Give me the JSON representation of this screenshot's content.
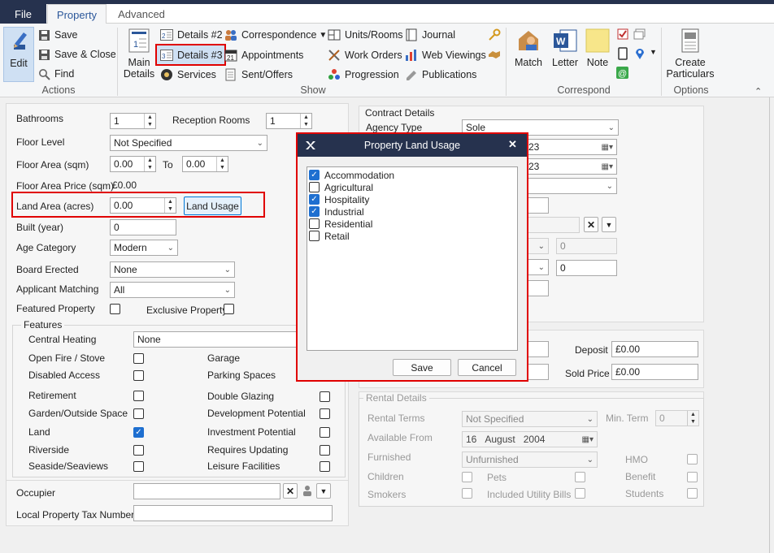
{
  "tabs": {
    "file": "File",
    "property": "Property",
    "advanced": "Advanced"
  },
  "ribbon": {
    "actions": {
      "edit": "Edit",
      "save": "Save",
      "save_close": "Save & Close",
      "find": "Find",
      "label": "Actions"
    },
    "show": {
      "main_details": [
        "Main",
        "Details"
      ],
      "details2": "Details #2",
      "details3": "Details #3",
      "services": "Services",
      "correspondence": "Correspondence",
      "appointments": "Appointments",
      "sent_offers": "Sent/Offers",
      "units_rooms": "Units/Rooms",
      "work_orders": "Work Orders",
      "progression": "Progression",
      "journal": "Journal",
      "web_viewings": "Web Viewings",
      "publications": "Publications",
      "label": "Show"
    },
    "correspond": {
      "match": "Match",
      "letter": "Letter",
      "note": "Note",
      "label": "Correspond"
    },
    "options": {
      "create": [
        "Create",
        "Particulars"
      ],
      "label": "Options"
    }
  },
  "form": {
    "bathrooms": {
      "label": "Bathrooms",
      "value": "1"
    },
    "reception": {
      "label": "Reception Rooms",
      "value": "1"
    },
    "floor_level": {
      "label": "Floor Level",
      "value": "Not Specified"
    },
    "floor_area": {
      "label": "Floor Area (sqm)",
      "from": "0.00",
      "to_label": "To",
      "to": "0.00"
    },
    "floor_price": {
      "label": "Floor Area Price (sqm)",
      "value": "£0.00"
    },
    "land_area": {
      "label": "Land Area (acres)",
      "value": "0.00",
      "button": "Land Usage"
    },
    "built": {
      "label": "Built (year)",
      "value": "0"
    },
    "age": {
      "label": "Age Category",
      "value": "Modern"
    },
    "board": {
      "label": "Board Erected",
      "value": "None"
    },
    "applicant": {
      "label": "Applicant Matching",
      "value": "All"
    },
    "featured": {
      "label": "Featured Property"
    },
    "exclusive": {
      "label": "Exclusive Property"
    },
    "features": {
      "legend": "Features",
      "central_heating": {
        "label": "Central Heating",
        "value": "None"
      },
      "left": [
        {
          "label": "Open Fire / Stove",
          "checked": false
        },
        {
          "label": "Disabled Access",
          "checked": false
        },
        {
          "label": "Retirement",
          "checked": false
        },
        {
          "label": "Garden/Outside Space",
          "checked": false
        },
        {
          "label": "Land",
          "checked": true
        },
        {
          "label": "Riverside",
          "checked": false
        },
        {
          "label": "Seaside/Seaviews",
          "checked": false
        }
      ],
      "right": [
        {
          "label": "Garage",
          "checked": false
        },
        {
          "label": "Parking Spaces",
          "checked": false
        },
        {
          "label": "Double Glazing",
          "checked": false
        },
        {
          "label": "Development Potential",
          "checked": false
        },
        {
          "label": "Investment Potential",
          "checked": false
        },
        {
          "label": "Requires Updating",
          "checked": false
        },
        {
          "label": "Leisure Facilities",
          "checked": false
        }
      ]
    },
    "occupier": {
      "label": "Occupier",
      "value": ""
    },
    "local_tax": {
      "label": "Local Property Tax Number",
      "value": ""
    }
  },
  "contract": {
    "legend": "Contract Details",
    "agency_type": {
      "label": "Agency Type",
      "value": "Sole"
    },
    "date1": "23",
    "date2": "23",
    "spin_a": "0",
    "spin_b": "0",
    "deposit": {
      "label": "Deposit",
      "value": "£0.00"
    },
    "sold_price": {
      "label": "Sold Price",
      "value": "£0.00"
    }
  },
  "rental": {
    "legend": "Rental Details",
    "terms": {
      "label": "Rental Terms",
      "value": "Not Specified"
    },
    "min_term": {
      "label": "Min. Term",
      "value": "0"
    },
    "available": {
      "label": "Available From",
      "day": "16",
      "month": "August",
      "year": "2004"
    },
    "furnished": {
      "label": "Furnished",
      "value": "Unfurnished"
    },
    "hmo": "HMO",
    "children": "Children",
    "pets": "Pets",
    "benefit": "Benefit",
    "smokers": "Smokers",
    "utility": "Included Utility Bills",
    "students": "Students"
  },
  "dialog": {
    "title": "Property Land Usage",
    "items": [
      {
        "label": "Accommodation",
        "checked": true
      },
      {
        "label": "Agricultural",
        "checked": false
      },
      {
        "label": "Hospitality",
        "checked": true
      },
      {
        "label": "Industrial",
        "checked": true
      },
      {
        "label": "Residential",
        "checked": false
      },
      {
        "label": "Retail",
        "checked": false
      }
    ],
    "save": "Save",
    "cancel": "Cancel"
  },
  "colors": {
    "accent": "#26324e",
    "highlight": "#e00000",
    "check": "#1e6fd0"
  }
}
